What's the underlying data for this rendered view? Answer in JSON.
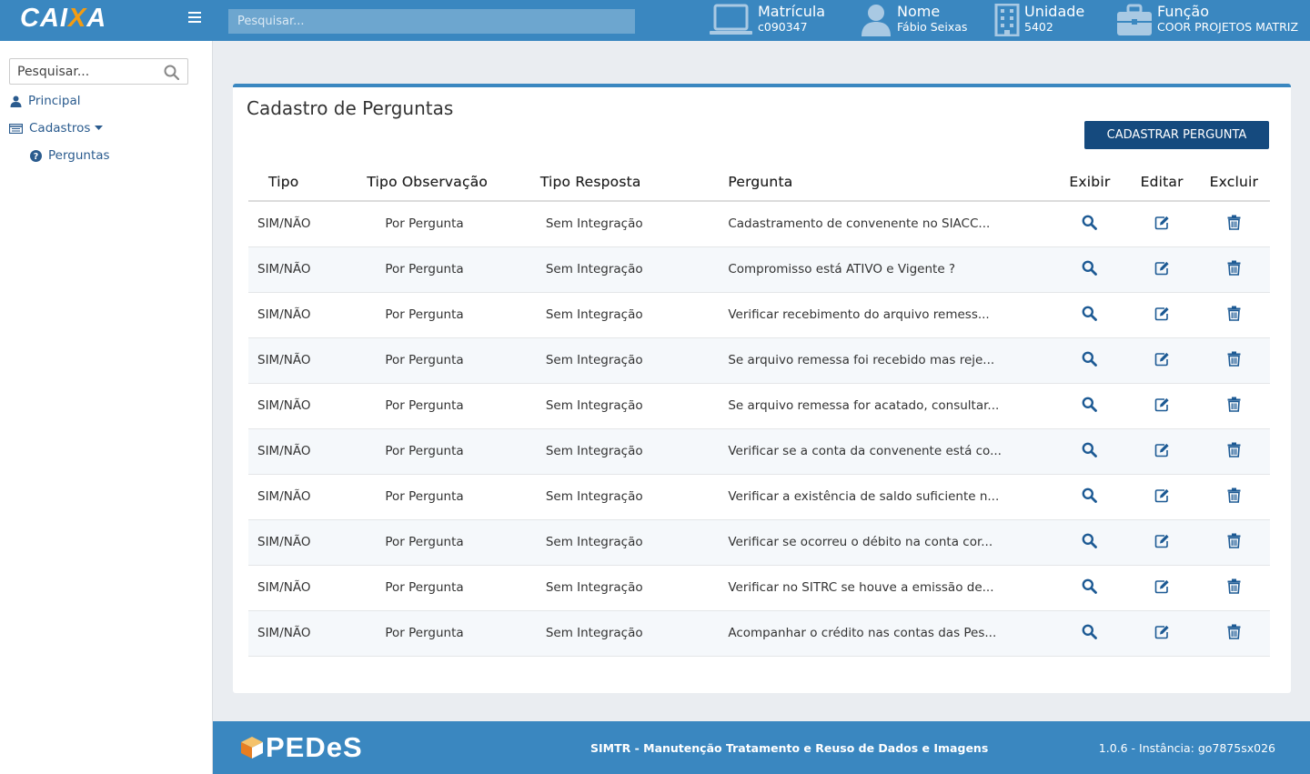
{
  "header": {
    "logo_left": "CAI",
    "logo_x": "X",
    "logo_right": "A",
    "search_placeholder": "Pesquisar...",
    "matricula_label": "Matrícula",
    "matricula_value": "c090347",
    "nome_label": "Nome",
    "nome_value": "Fábio Seixas",
    "unidade_label": "Unidade",
    "unidade_value": "5402",
    "funcao_label": "Função",
    "funcao_value": "COOR PROJETOS MATRIZ"
  },
  "sidebar": {
    "search_placeholder": "Pesquisar...",
    "items": [
      {
        "label": "Principal",
        "icon": "user-icon"
      },
      {
        "label": "Cadastros",
        "icon": "list-icon"
      },
      {
        "label": "Perguntas",
        "icon": "question-circle-icon"
      }
    ]
  },
  "main": {
    "title": "Cadastro de Perguntas",
    "add_button": "CADASTRAR PERGUNTA",
    "columns": [
      "Tipo",
      "Tipo Observação",
      "Tipo Resposta",
      "Pergunta",
      "Exibir",
      "Editar",
      "Excluir"
    ],
    "rows": [
      {
        "tipo": "SIM/NÃO",
        "obs": "Por Pergunta",
        "resp": "Sem Integração",
        "pergunta": "Cadastramento de convenente no SIACC..."
      },
      {
        "tipo": "SIM/NÃO",
        "obs": "Por Pergunta",
        "resp": "Sem Integração",
        "pergunta": "Compromisso está ATIVO e Vigente ?"
      },
      {
        "tipo": "SIM/NÃO",
        "obs": "Por Pergunta",
        "resp": "Sem Integração",
        "pergunta": "Verificar recebimento do arquivo remess..."
      },
      {
        "tipo": "SIM/NÃO",
        "obs": "Por Pergunta",
        "resp": "Sem Integração",
        "pergunta": "Se arquivo remessa foi recebido mas reje..."
      },
      {
        "tipo": "SIM/NÃO",
        "obs": "Por Pergunta",
        "resp": "Sem Integração",
        "pergunta": "Se arquivo remessa for acatado, consultar..."
      },
      {
        "tipo": "SIM/NÃO",
        "obs": "Por Pergunta",
        "resp": "Sem Integração",
        "pergunta": "Verificar se a conta da convenente está co..."
      },
      {
        "tipo": "SIM/NÃO",
        "obs": "Por Pergunta",
        "resp": "Sem Integração",
        "pergunta": "Verificar a existência de saldo suficiente n..."
      },
      {
        "tipo": "SIM/NÃO",
        "obs": "Por Pergunta",
        "resp": "Sem Integração",
        "pergunta": "Verificar se ocorreu o débito na conta cor..."
      },
      {
        "tipo": "SIM/NÃO",
        "obs": "Por Pergunta",
        "resp": "Sem Integração",
        "pergunta": "Verificar no SITRC se houve a emissão de..."
      },
      {
        "tipo": "SIM/NÃO",
        "obs": "Por Pergunta",
        "resp": "Sem Integração",
        "pergunta": "Acompanhar o crédito nas contas das Pes..."
      }
    ]
  },
  "footer": {
    "logo_text": "PEDeS",
    "system_name": "SIMTR - Manutenção Tratamento e Reuso de Dados e Imagens",
    "version": "1.0.6 - Instância: go7875sx026"
  },
  "colors": {
    "primary": "#3a87c0",
    "button": "#154a7e",
    "icon_blue": "#1d5a94",
    "logo_accent": "#f39c12"
  }
}
